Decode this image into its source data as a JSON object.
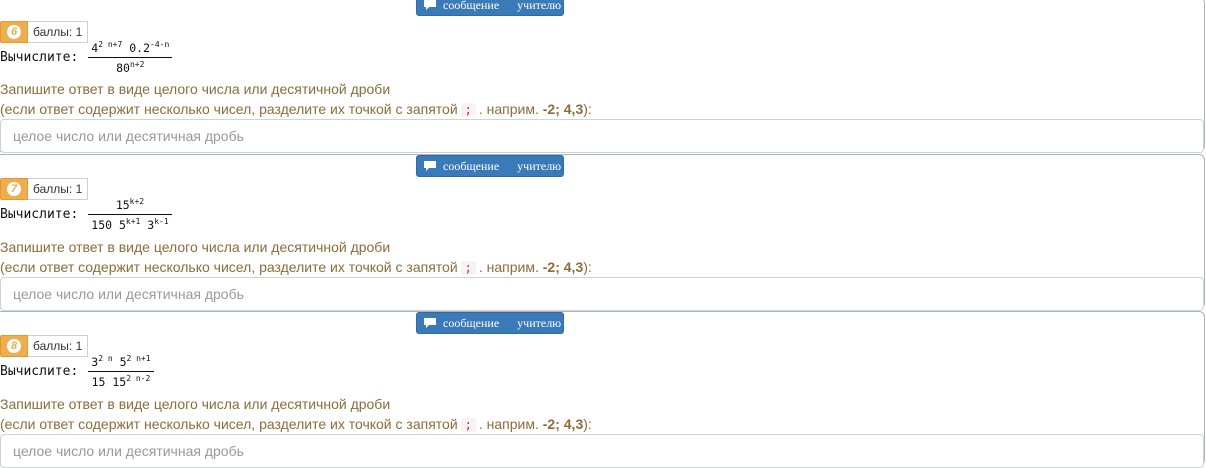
{
  "common": {
    "message_button": "сообщение  учителю",
    "calc_label": "Вычислите:",
    "hint_line1": "Запишите ответ в виде целого числа или десятичной дроби",
    "hint_line2_prefix": "(если ответ содержит несколько чисел, разделите их точкой с запятой",
    "hint_separator": ";",
    "hint_line2_mid": ". наприм.",
    "hint_example": "-2; 4,3",
    "hint_line2_suffix": "):",
    "answer_placeholder": "целое число или десятичная дробь"
  },
  "tasks": [
    {
      "number": "6",
      "score": "баллы: 1",
      "num": {
        "b1": "4",
        "e1": "2 n+7",
        "b2": " 0.2",
        "e2": "-4-n"
      },
      "den": {
        "b1": "80",
        "e1": "n+2",
        "b2": "",
        "e2": ""
      }
    },
    {
      "number": "7",
      "score": "баллы: 1",
      "num": {
        "b1": "15",
        "e1": "k+2",
        "b2": "",
        "e2": ""
      },
      "den": {
        "b1": "150 5",
        "e1": "k+1",
        "b2": " 3",
        "e2": "k-1"
      }
    },
    {
      "number": "8",
      "score": "баллы: 1",
      "num": {
        "b1": "3",
        "e1": "2 n",
        "b2": " 5",
        "e2": "2 n+1"
      },
      "den": {
        "b1": "15 15",
        "e1": "2 n-2",
        "b2": "",
        "e2": ""
      }
    }
  ],
  "colors": {
    "accent_blue": "#3b7ab8",
    "badge_orange": "#f0ad4e",
    "hint_brown": "#8a6d3b",
    "code_red": "#c7254e"
  }
}
